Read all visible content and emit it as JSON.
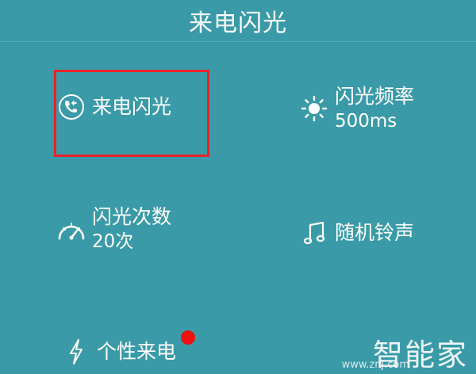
{
  "header": {
    "title": "来电闪光"
  },
  "tiles": {
    "call_flash": {
      "label": "来电闪光",
      "icon": "incoming-call-icon"
    },
    "flash_frequency": {
      "label": "闪光频率",
      "value": "500ms",
      "icon": "sun-icon"
    },
    "flash_count": {
      "label": "闪光次数",
      "value": "20次",
      "icon": "speedometer-icon"
    },
    "random_ringtone": {
      "label": "随机铃声",
      "icon": "music-note-icon"
    },
    "personal_call": {
      "label": "个性来电",
      "icon": "lightning-icon",
      "has_notification": true
    }
  },
  "watermark": {
    "brand": "智能家",
    "url": "www.znj.com"
  },
  "colors": {
    "background": "#3a9aa8",
    "highlight_border": "#e8242b",
    "notification_dot": "#ee1111",
    "foreground": "#ffffff"
  }
}
